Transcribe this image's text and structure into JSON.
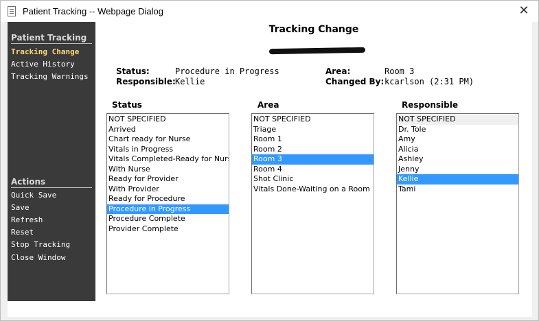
{
  "window": {
    "title": "Patient Tracking -- Webpage Dialog",
    "close_label": "✕"
  },
  "sidebar": {
    "section_title": "Patient Tracking",
    "nav_items": [
      "Tracking Change",
      "Active History",
      "Tracking Warnings"
    ],
    "actions_title": "Actions",
    "action_items": [
      "Quick Save",
      "Save",
      "Refresh",
      "Reset",
      "Stop Tracking",
      "Close Window"
    ]
  },
  "main": {
    "title": "Tracking Change",
    "status_label": "Status:",
    "status_value": "Procedure in Progress",
    "responsible_label": "Responsible:",
    "responsible_value": "Kellie",
    "area_label": "Area:",
    "area_value": "Room 3",
    "changed_by_label": "Changed By:",
    "changed_by_value": "kcarlson (2:31 PM)"
  },
  "lists": {
    "status": {
      "header": "Status",
      "options": [
        "NOT SPECIFIED",
        "Arrived",
        "Chart ready for Nurse",
        "Vitals in Progress",
        "Vitals Completed-Ready for Nurse",
        "With Nurse",
        "Ready for Provider",
        "With Provider",
        "Ready for Procedure",
        "Procedure in Progress",
        "Procedure Complete",
        "Provider Complete"
      ],
      "selected": "Procedure in Progress"
    },
    "area": {
      "header": "Area",
      "options": [
        "NOT SPECIFIED",
        "Triage",
        "Room 1",
        "Room 2",
        "Room 3",
        "Room 4",
        "Shot Clinic",
        "Vitals Done-Waiting on a Room"
      ],
      "selected": "Room 3"
    },
    "responsible": {
      "header": "Responsible",
      "options": [
        "NOT SPECIFIED",
        "Dr. Tole",
        "Amy",
        "Alicia",
        "Ashley",
        "Jenny",
        "Kellie",
        "Tami"
      ],
      "selected": "Kellie"
    }
  },
  "colors": {
    "sidebar_bg": "#3a3a3a",
    "active_nav": "#ffd87a",
    "selection": "#3399ff"
  }
}
